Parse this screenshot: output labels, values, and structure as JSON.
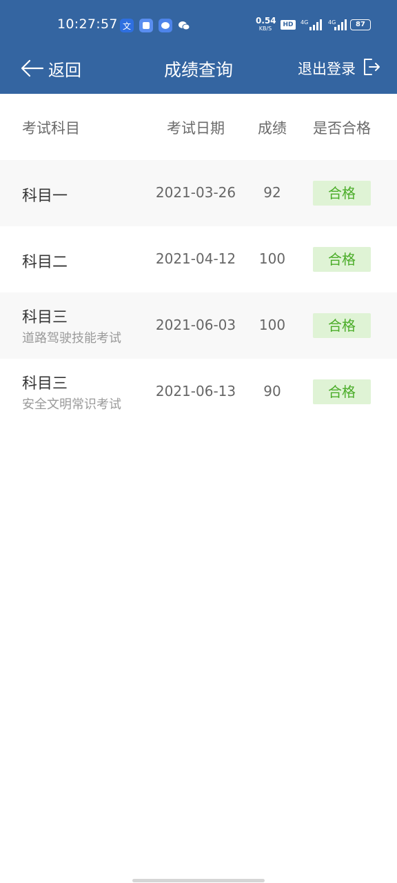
{
  "status_bar": {
    "time": "10:27:57",
    "net_speed_value": "0.54",
    "net_speed_unit": "KB/S",
    "hd_label": "HD",
    "signal_1_label": "4G",
    "signal_2_label": "4G",
    "battery": "87"
  },
  "header": {
    "back_label": "返回",
    "title": "成绩查询",
    "logout_label": "退出登录",
    "background": "#3465a1"
  },
  "table": {
    "columns": {
      "subject": "考试科目",
      "date": "考试日期",
      "score": "成绩",
      "pass": "是否合格"
    },
    "rows": [
      {
        "subject": "科目一",
        "subtitle": "",
        "date": "2021-03-26",
        "score": "92",
        "pass": "合格"
      },
      {
        "subject": "科目二",
        "subtitle": "",
        "date": "2021-04-12",
        "score": "100",
        "pass": "合格"
      },
      {
        "subject": "科目三",
        "subtitle": "道路驾驶技能考试",
        "date": "2021-06-03",
        "score": "100",
        "pass": "合格"
      },
      {
        "subject": "科目三",
        "subtitle": "安全文明常识考试",
        "date": "2021-06-13",
        "score": "90",
        "pass": "合格"
      }
    ]
  },
  "colors": {
    "pass_badge_bg": "#dff3d5",
    "pass_badge_text": "#4aac28"
  }
}
